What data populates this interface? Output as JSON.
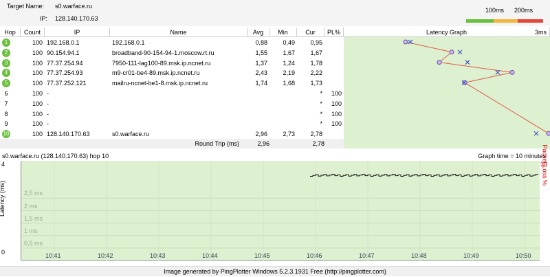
{
  "header": {
    "target_label": "Target Name:",
    "target_value": "s0.warface.ru",
    "ip_label": "IP:",
    "ip_value": "128.140.170.63",
    "legend": {
      "low": "100ms",
      "high": "200ms",
      "colors": [
        "#6cbf3e",
        "#f2b640",
        "#e04a3a"
      ]
    }
  },
  "table": {
    "columns": [
      "Hop",
      "Count",
      "IP",
      "Name",
      "Avg",
      "Min",
      "Cur",
      "PL%",
      "Latency Graph",
      "3ms"
    ],
    "rows": [
      {
        "hop": "1",
        "count": "100",
        "ip": "192.168.0.1",
        "name": "192.168.0.1",
        "avg": "0,88",
        "min": "0,49",
        "cur": "0,95",
        "pl": "",
        "badge": true
      },
      {
        "hop": "2",
        "count": "100",
        "ip": "90.154.94.1",
        "name": "broadband-90-154-94-1.moscow.rt.ru",
        "avg": "1,55",
        "min": "1,67",
        "cur": "1,67",
        "pl": "",
        "badge": true
      },
      {
        "hop": "3",
        "count": "100",
        "ip": "77.37.254.94",
        "name": "7950-111-lag100-89.msk.ip.ncnet.ru",
        "avg": "1,37",
        "min": "1,24",
        "cur": "1,78",
        "pl": "",
        "badge": true
      },
      {
        "hop": "4",
        "count": "100",
        "ip": "77.37.254.93",
        "name": "m9-cr01-be4-89.msk.ip.ncnet.ru",
        "avg": "2,43",
        "min": "2,19",
        "cur": "2,22",
        "pl": "",
        "badge": true
      },
      {
        "hop": "5",
        "count": "100",
        "ip": "77.37.252.121",
        "name": "mailru-ncnet-be1-8.msk.ip.ncnet.ru",
        "avg": "1,74",
        "min": "1,68",
        "cur": "1,73",
        "pl": "",
        "badge": true
      },
      {
        "hop": "6",
        "count": "100",
        "ip": "-",
        "name": "",
        "avg": "",
        "min": "",
        "cur": "*",
        "pl": "100",
        "badge": false
      },
      {
        "hop": "7",
        "count": "100",
        "ip": "-",
        "name": "",
        "avg": "",
        "min": "",
        "cur": "*",
        "pl": "100",
        "badge": false
      },
      {
        "hop": "8",
        "count": "100",
        "ip": "-",
        "name": "",
        "avg": "",
        "min": "",
        "cur": "*",
        "pl": "100",
        "badge": false
      },
      {
        "hop": "9",
        "count": "100",
        "ip": "-",
        "name": "",
        "avg": "",
        "min": "",
        "cur": "*",
        "pl": "100",
        "badge": false
      },
      {
        "hop": "10",
        "count": "100",
        "ip": "128.140.170.63",
        "name": "s0.warface.ru",
        "avg": "2,96",
        "min": "2,73",
        "cur": "2,78",
        "pl": "",
        "badge": true
      }
    ],
    "round_trip": {
      "label": "Round Trip (ms)",
      "avg": "2,96",
      "cur": "2,78"
    }
  },
  "graph": {
    "title": "s0.warface.ru (128.140.170.63) hop 10",
    "time_label": "Graph time = 10 minutes",
    "ylabel": "Latency (ms)",
    "y2label": "Packet Loss %",
    "y2max": "30",
    "yticks": [
      "4",
      "0"
    ],
    "gridticks": [
      "2,5 ms",
      "2 ms",
      "1,5 ms",
      "1 ms",
      "0,5 ms"
    ],
    "xticks": [
      "10:41",
      "10:42",
      "10:43",
      "10:44",
      "10:45",
      "10:46",
      "10:47",
      "10:48",
      "10:49",
      "10:50"
    ]
  },
  "footer": "Image generated by PingPlotter Windows 5.2.3.1931 Free (http://pingplotter.com)"
}
